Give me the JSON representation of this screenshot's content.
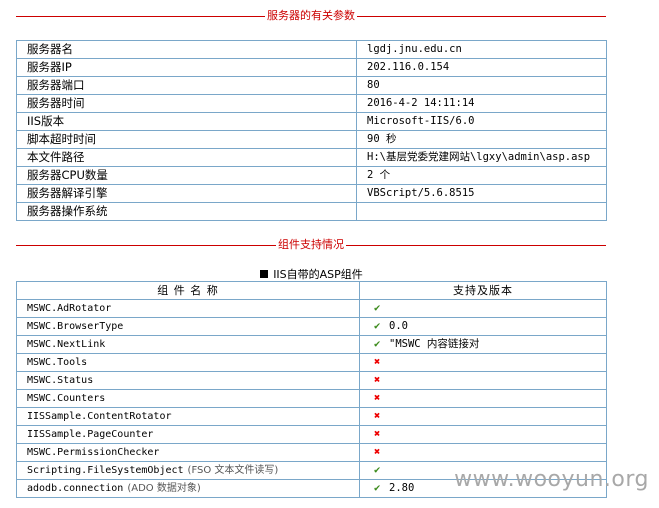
{
  "server_section": {
    "title": "服务器的有关参数",
    "rows": [
      {
        "key": "服务器名",
        "value": "lgdj.jnu.edu.cn"
      },
      {
        "key": "服务器IP",
        "value": "202.116.0.154"
      },
      {
        "key": "服务器端口",
        "value": "80"
      },
      {
        "key": "服务器时间",
        "value": "2016-4-2 14:11:14"
      },
      {
        "key": "IIS版本",
        "value": "Microsoft-IIS/6.0"
      },
      {
        "key": "脚本超时时间",
        "value": "90 秒"
      },
      {
        "key": "本文件路径",
        "value": "H:\\基层党委党建网站\\lgxy\\admin\\asp.asp"
      },
      {
        "key": "服务器CPU数量",
        "value": "2 个"
      },
      {
        "key": "服务器解译引擎",
        "value": "VBScript/5.6.8515"
      },
      {
        "key": "服务器操作系统",
        "value": ""
      }
    ]
  },
  "component_section": {
    "title": "组件支持情况",
    "caption": "IIS自带的ASP组件",
    "headers": {
      "name": "组 件 名 称",
      "support": "支持及版本"
    },
    "rows": [
      {
        "name": "MSWC.AdRotator",
        "note": "",
        "status": "ok",
        "version": ""
      },
      {
        "name": "MSWC.BrowserType",
        "note": "",
        "status": "ok",
        "version": "0.0"
      },
      {
        "name": "MSWC.NextLink",
        "note": "",
        "status": "ok",
        "version": "\"MSWC 内容链接对"
      },
      {
        "name": "MSWC.Tools",
        "note": "",
        "status": "no",
        "version": ""
      },
      {
        "name": "MSWC.Status",
        "note": "",
        "status": "no",
        "version": ""
      },
      {
        "name": "MSWC.Counters",
        "note": "",
        "status": "no",
        "version": ""
      },
      {
        "name": "IISSample.ContentRotator",
        "note": "",
        "status": "no",
        "version": ""
      },
      {
        "name": "IISSample.PageCounter",
        "note": "",
        "status": "no",
        "version": ""
      },
      {
        "name": "MSWC.PermissionChecker",
        "note": "",
        "status": "no",
        "version": ""
      },
      {
        "name": "Scripting.FileSystemObject",
        "note": "(FSO 文本文件读写)",
        "status": "ok",
        "version": ""
      },
      {
        "name": "adodb.connection",
        "note": "(ADO 数据对象)",
        "status": "ok",
        "version": "2.80"
      }
    ]
  },
  "icons": {
    "ok": "checkmark-icon",
    "no": "cross-icon"
  },
  "colors": {
    "title": "#cc0000",
    "border": "#7aa7c9",
    "ok": "#3a8a1a",
    "no": "#ee0000"
  },
  "watermark": "www.wooyun.org"
}
